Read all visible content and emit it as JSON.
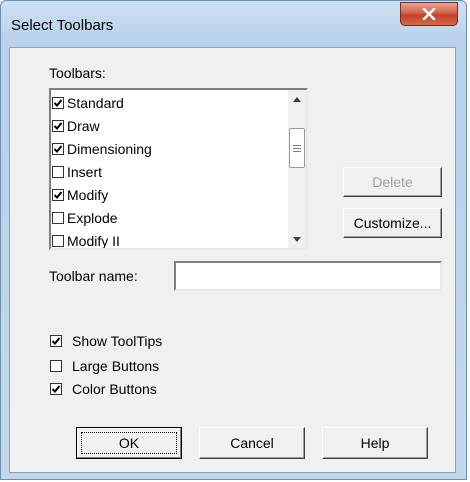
{
  "window": {
    "title": "Select Toolbars"
  },
  "toolbars": {
    "label": "Toolbars:",
    "items": [
      {
        "label": "Standard",
        "checked": true
      },
      {
        "label": "Draw",
        "checked": true
      },
      {
        "label": "Dimensioning",
        "checked": true
      },
      {
        "label": "Insert",
        "checked": false
      },
      {
        "label": "Modify",
        "checked": true
      },
      {
        "label": "Explode",
        "checked": false
      },
      {
        "label": "Modify II",
        "checked": false
      }
    ]
  },
  "side_buttons": {
    "delete_label": "Delete",
    "customize_label": "Customize..."
  },
  "toolbar_name": {
    "label": "Toolbar name:",
    "value": ""
  },
  "options": [
    {
      "label": "Show ToolTips",
      "checked": true
    },
    {
      "label": "Large Buttons",
      "checked": false
    },
    {
      "label": "Color Buttons",
      "checked": true
    }
  ],
  "footer": {
    "ok_label": "OK",
    "cancel_label": "Cancel",
    "help_label": "Help"
  }
}
